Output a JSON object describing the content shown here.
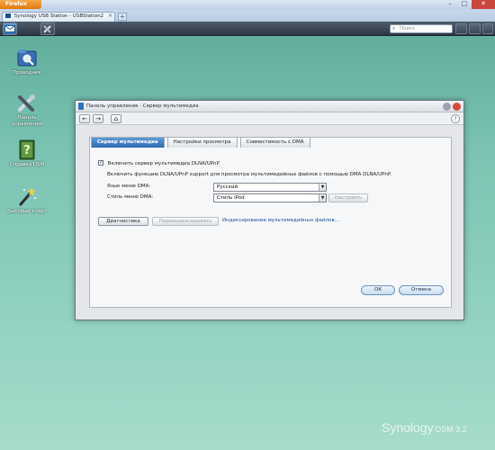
{
  "browser": {
    "menu_button": "Firefox",
    "tab_title": "Synology USB Station - USBStation2",
    "new_tab": "+"
  },
  "taskbar": {
    "search_placeholder": "Поиск"
  },
  "desktop": {
    "icons": [
      {
        "label": "Проводник",
        "icon": "file-browser-icon"
      },
      {
        "label": "Панель управления",
        "icon": "control-panel-icon"
      },
      {
        "label": "Справка DSM",
        "icon": "dsm-help-icon"
      },
      {
        "label": "Быстрый старт",
        "icon": "quick-start-icon"
      }
    ]
  },
  "window": {
    "title": "Панель управления - Сервер мультимедиа",
    "tabs": [
      {
        "label": "Сервер мультимедиа",
        "active": true
      },
      {
        "label": "Настройки просмотра",
        "active": false
      },
      {
        "label": "Совместимость с DMA",
        "active": false
      }
    ],
    "enable_checkbox": {
      "label": "Включить сервер мультимедиа DLNA/UPnP",
      "checked": true
    },
    "description": "Включить функцию DLNA/UPnP support для просмотра мультимедийных файлов с помощью DMA DLNA/UPnP.",
    "dma_language": {
      "label": "Язык меню DMA:",
      "value": "Русский"
    },
    "dma_style": {
      "label": "Стиль меню DMA:",
      "value": "Стиль iPod"
    },
    "customize_button": "Настроить",
    "diagnostics_button": "Диагностика",
    "reindex_button": "Переиндексировать",
    "indexing_link": "Индексирование мультимедийных файлов...",
    "ok_button": "ОК",
    "cancel_button": "Отмена"
  },
  "branding": {
    "name": "Synology",
    "product": "DSM 3.2"
  },
  "colors": {
    "desktop": "#7cc4b3",
    "accent": "#2c6ab0",
    "link": "#1c4fa0"
  }
}
